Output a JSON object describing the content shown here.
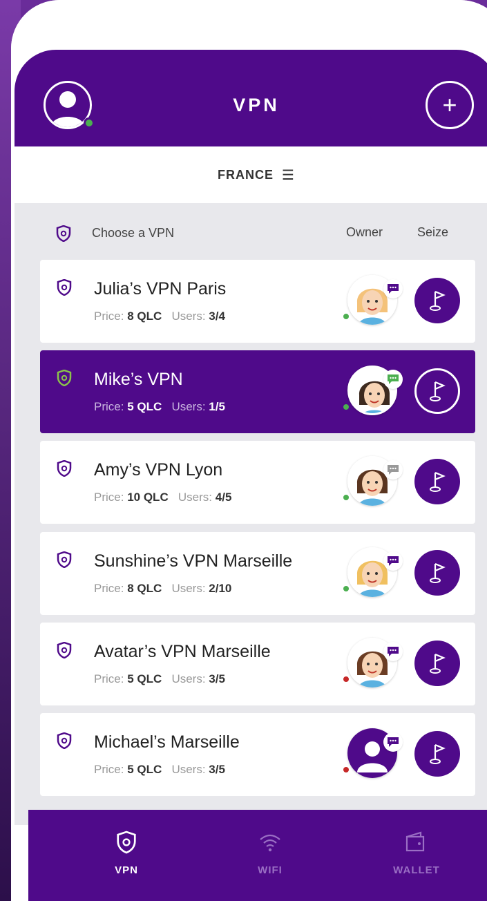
{
  "header": {
    "title": "VPN",
    "add_symbol": "+"
  },
  "region": {
    "label": "FRANCE",
    "menu_icon": "☰"
  },
  "list_header": {
    "choose": "Choose a VPN",
    "owner": "Owner",
    "seize": "Seize"
  },
  "vpns": [
    {
      "title": "Julia’s VPN Paris",
      "price_label": "Price:",
      "price": "8 QLC",
      "users_label": "Users:",
      "users": "3/4",
      "status": "online",
      "active": false,
      "chat_color": "#4f0a8a"
    },
    {
      "title": "Mike’s VPN",
      "price_label": "Price:",
      "price": "5 QLC",
      "users_label": "Users:",
      "users": "1/5",
      "status": "online",
      "active": true,
      "chat_color": "#4caf50"
    },
    {
      "title": "Amy’s VPN Lyon",
      "price_label": "Price:",
      "price": "10 QLC",
      "users_label": "Users:",
      "users": "4/5",
      "status": "online",
      "active": false,
      "chat_color": "#999999"
    },
    {
      "title": "Sunshine’s VPN Marseille",
      "price_label": "Price:",
      "price": "8 QLC",
      "users_label": "Users:",
      "users": "2/10",
      "status": "online",
      "active": false,
      "chat_color": "#4f0a8a"
    },
    {
      "title": "Avatar’s VPN Marseille",
      "price_label": "Price:",
      "price": "5 QLC",
      "users_label": "Users:",
      "users": "3/5",
      "status": "offline",
      "active": false,
      "chat_color": "#4f0a8a"
    },
    {
      "title": "Michael’s Marseille",
      "price_label": "Price:",
      "price": "5 QLC",
      "users_label": "Users:",
      "users": "3/5",
      "status": "offline",
      "active": false,
      "chat_color": "#4f0a8a"
    }
  ],
  "tabs": [
    {
      "label": "VPN",
      "icon": "shield-icon",
      "active": true
    },
    {
      "label": "WIFI",
      "icon": "wifi-icon",
      "active": false
    },
    {
      "label": "WALLET",
      "icon": "wallet-icon",
      "active": false
    }
  ],
  "colors": {
    "primary": "#4f0a8a",
    "online": "#4caf50",
    "offline": "#c62828",
    "surface": "#e8e8ec"
  }
}
